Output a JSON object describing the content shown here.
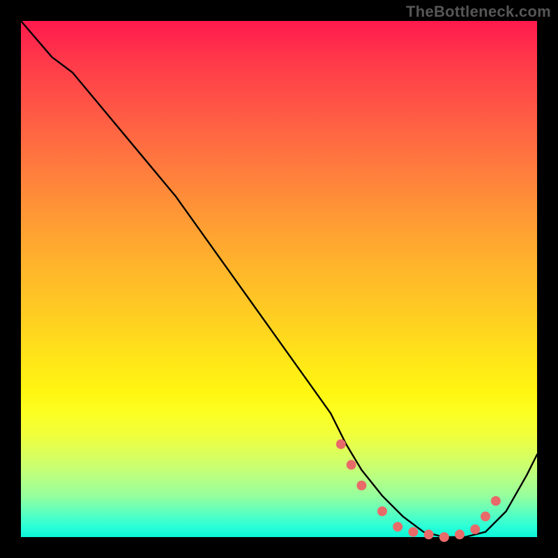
{
  "watermark": "TheBottleneck.com",
  "colors": {
    "background": "#000000",
    "line": "#000000",
    "marker": "#e86b6a"
  },
  "chart_data": {
    "type": "line",
    "title": "",
    "xlabel": "",
    "ylabel": "",
    "xlim": [
      0,
      100
    ],
    "ylim": [
      0,
      100
    ],
    "grid": false,
    "legend": false,
    "series": [
      {
        "name": "bottleneck-curve",
        "x": [
          0,
          6,
          10,
          15,
          20,
          25,
          30,
          35,
          40,
          45,
          50,
          55,
          60,
          63,
          66,
          70,
          74,
          78,
          82,
          86,
          90,
          94,
          98,
          100
        ],
        "y": [
          100,
          93,
          90,
          84,
          78,
          72,
          66,
          59,
          52,
          45,
          38,
          31,
          24,
          18,
          13,
          8,
          4,
          1,
          0,
          0,
          1,
          5,
          12,
          16
        ]
      }
    ],
    "markers": {
      "name": "highlight-points",
      "x": [
        62,
        64,
        66,
        70,
        73,
        76,
        79,
        82,
        85,
        88,
        90,
        92
      ],
      "y": [
        18,
        14,
        10,
        5,
        2,
        1,
        0.5,
        0,
        0.5,
        1.5,
        4,
        7
      ]
    }
  }
}
